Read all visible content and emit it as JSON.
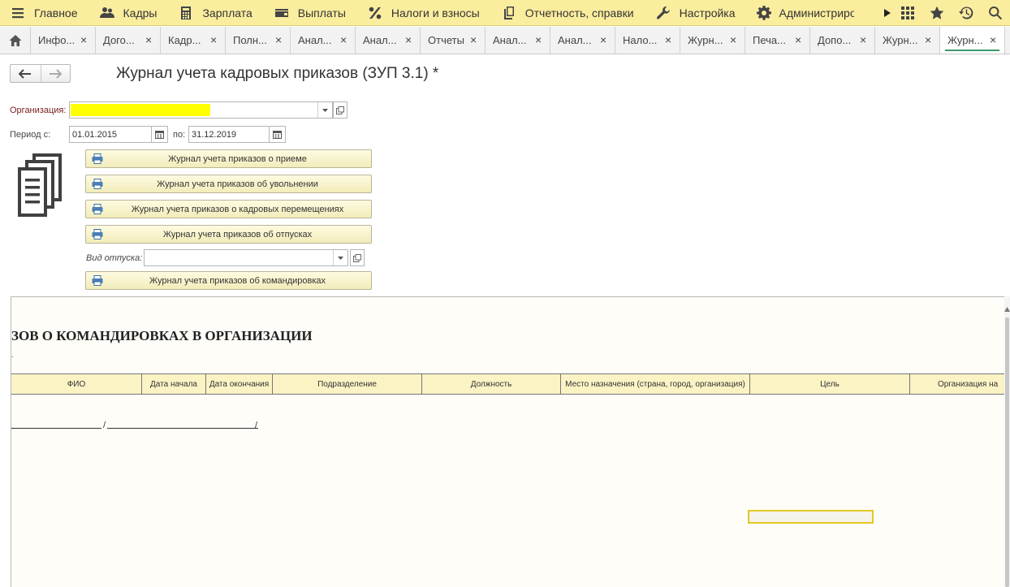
{
  "topbar": {
    "items": [
      {
        "label": "Главное",
        "icon": "hamburger-icon"
      },
      {
        "label": "Кадры",
        "icon": "people-icon"
      },
      {
        "label": "Зарплата",
        "icon": "calculator-icon"
      },
      {
        "label": "Выплаты",
        "icon": "wallet-icon"
      },
      {
        "label": "Налоги и взносы",
        "icon": "percent-icon"
      },
      {
        "label": "Отчетность, справки",
        "icon": "copy-docs-icon"
      },
      {
        "label": "Настройка",
        "icon": "wrench-icon"
      },
      {
        "label": "Администрирование",
        "icon": "gear-icon"
      }
    ],
    "right_icons": [
      "scroll-right-arrow-icon",
      "apps-grid-icon",
      "star-icon",
      "history-icon",
      "search-icon"
    ]
  },
  "tabs": {
    "home_icon": "home-icon",
    "items": [
      {
        "label": "Инфо..."
      },
      {
        "label": "Дого..."
      },
      {
        "label": "Кадр..."
      },
      {
        "label": "Полн..."
      },
      {
        "label": "Анал..."
      },
      {
        "label": "Анал..."
      },
      {
        "label": "Отчеты"
      },
      {
        "label": "Анал..."
      },
      {
        "label": "Анал..."
      },
      {
        "label": "Нало..."
      },
      {
        "label": "Журн..."
      },
      {
        "label": "Печа..."
      },
      {
        "label": "Допо..."
      },
      {
        "label": "Журн..."
      },
      {
        "label": "Журн...",
        "active": true
      }
    ],
    "close_glyph": "×"
  },
  "form": {
    "title": "Журнал учета кадровых приказов (ЗУП 3.1) *",
    "org_label": "Организация:",
    "org_value": "",
    "period_from_label": "Период с:",
    "period_from_value": "01.01.2015",
    "period_to_label": "по:",
    "period_to_value": "31.12.2019",
    "buttons": {
      "hire": "Журнал учета приказов о приеме",
      "dismissal": "Журнал учета приказов об увольнении",
      "transfers": "Журнал учета приказов о кадровых перемещениях",
      "vacations": "Журнал учета приказов об отпусках",
      "business_trips": "Журнал учета приказов об командировках"
    },
    "vacation_type_label": "Вид отпуска:",
    "vacation_type_value": ""
  },
  "report": {
    "heading": "ЗОВ О КОМАНДИРОВКАХ В ОРГАНИЗАЦИИ",
    "subheading": ".",
    "columns": [
      "ФИО",
      "Дата начала",
      "Дата окончания",
      "Подразделение",
      "Должность",
      "Место назначения (страна, город, организация)",
      "Цель",
      "Организация на"
    ],
    "signature_slash": "/"
  },
  "colors": {
    "menu_bg": "#fbed9e",
    "active_tab_underline": "#3d9a6a",
    "org_highlight": "#ffff00",
    "table_header_bg": "#fcf3c5",
    "selected_cell_border": "#e3c824"
  }
}
